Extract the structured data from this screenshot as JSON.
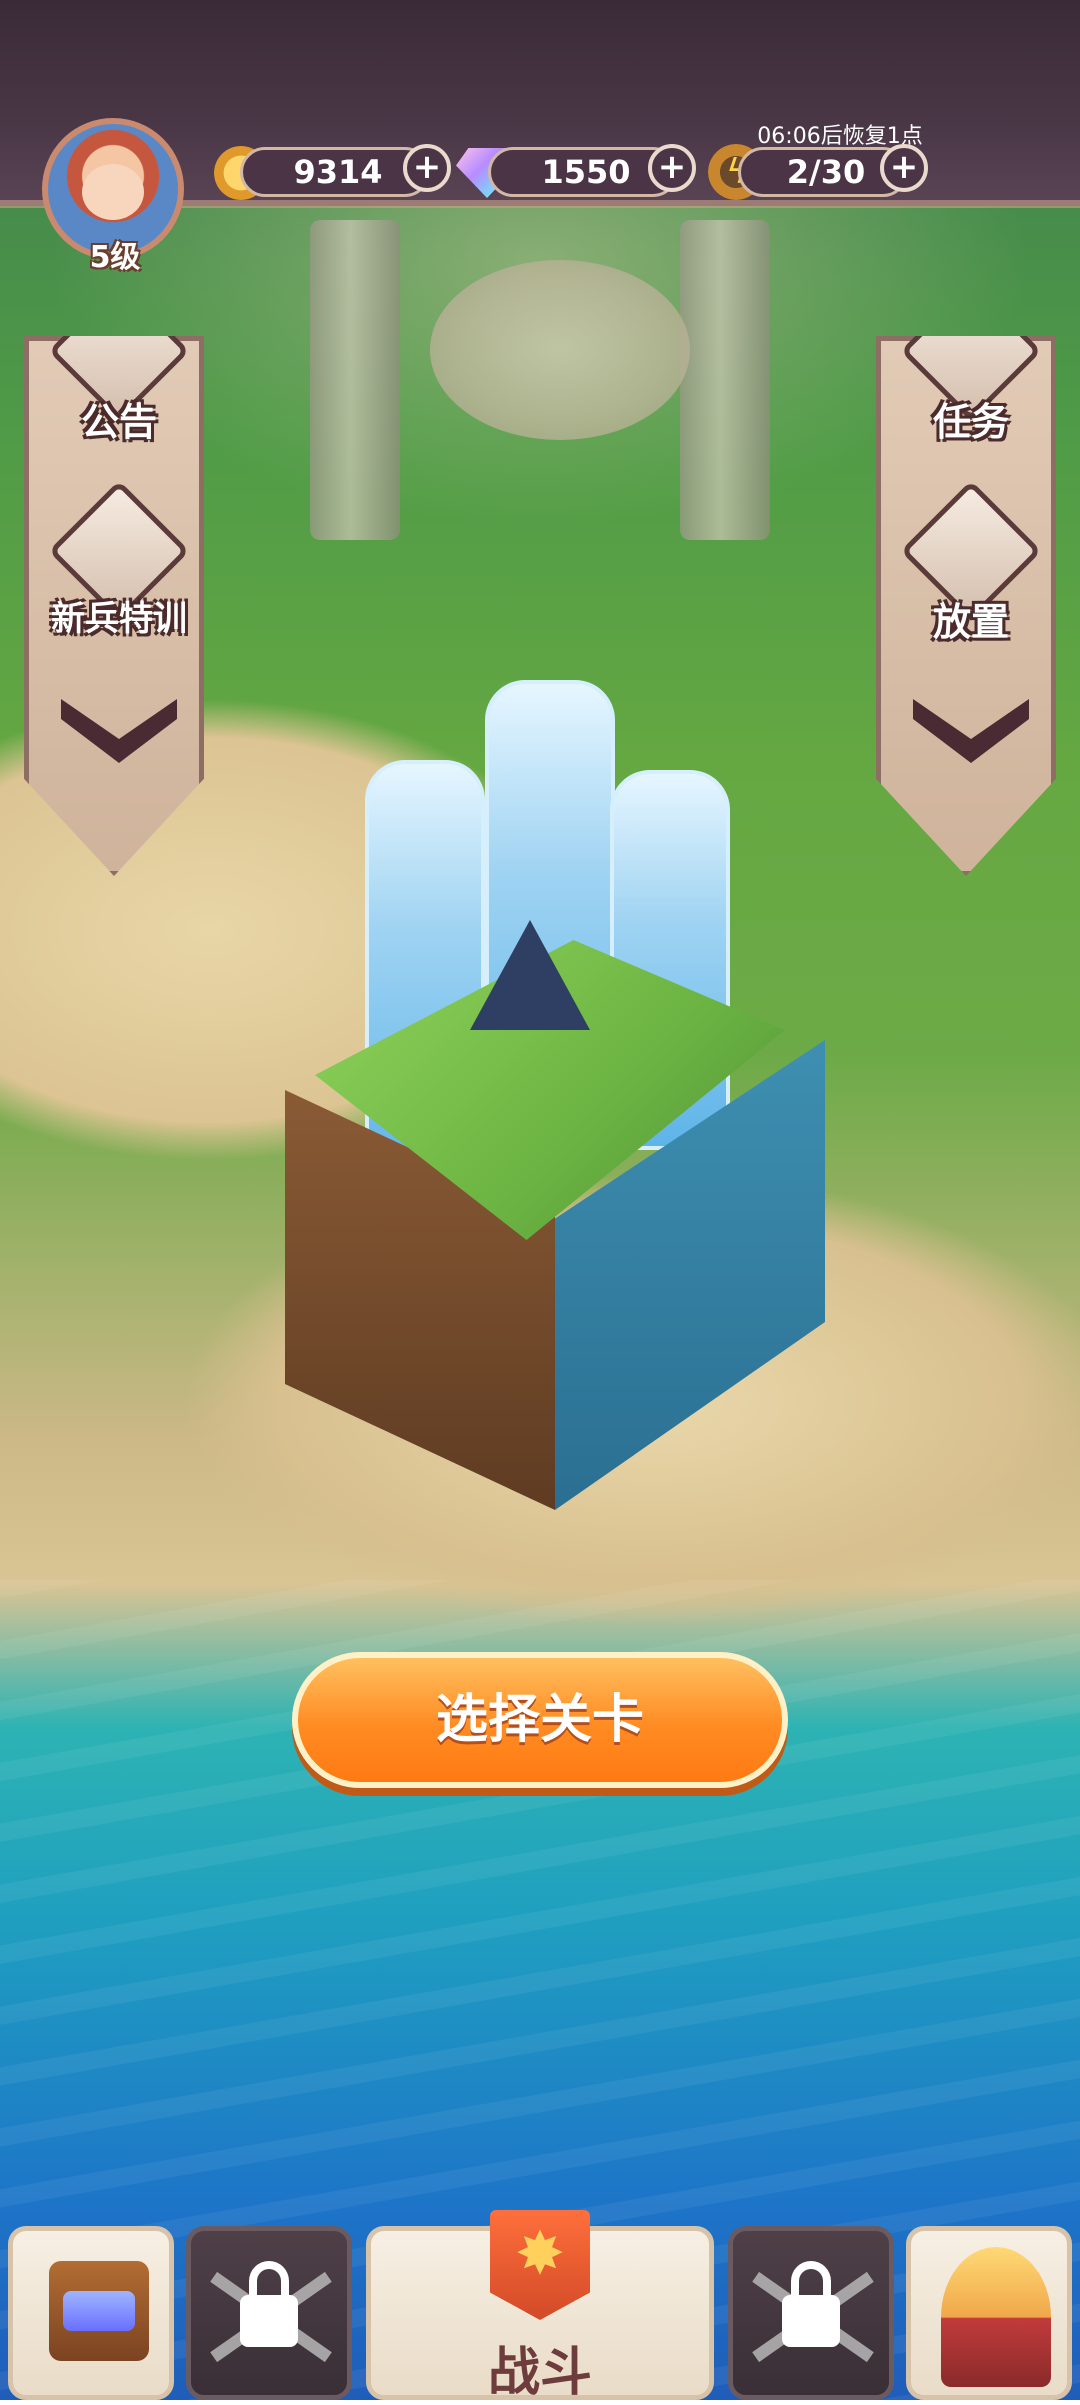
{
  "player": {
    "level": "5级"
  },
  "resources": {
    "coins": "9314",
    "gems": "1550",
    "energy": "2/30",
    "energy_timer": "06:06后恢复1点"
  },
  "left_panel": {
    "items": [
      {
        "label": "公告",
        "icon": "notice-icon"
      },
      {
        "label": "新兵特训",
        "icon": "knight-icon"
      }
    ]
  },
  "right_panel": {
    "items": [
      {
        "label": "任务",
        "icon": "task-icon"
      },
      {
        "label": "放置",
        "icon": "idle-icon"
      }
    ]
  },
  "main": {
    "select_stage_label": "选择关卡"
  },
  "bottom_nav": {
    "battle_label": "战斗"
  },
  "colors": {
    "topbar": "#3a2a37",
    "accent_orange": "#ff8b23",
    "panel_border": "#8e6e64"
  }
}
